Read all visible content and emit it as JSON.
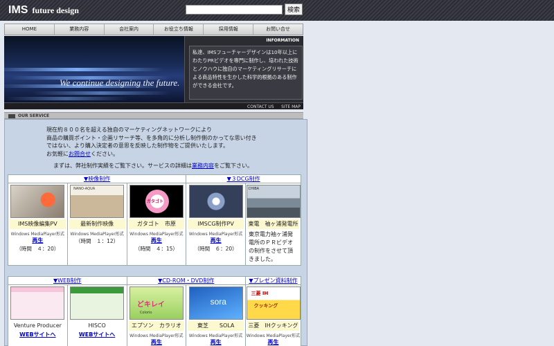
{
  "header": {
    "logo_main": "IMS",
    "logo_sub": "future design",
    "search_placeholder": "",
    "search_button": "検索"
  },
  "nav": [
    "HOME",
    "業務内容",
    "会社案内",
    "お役立ち情報",
    "採用情報",
    "お問い合せ"
  ],
  "hero": {
    "tagline": "We continue designing the future.",
    "info_label": "INFORMATION",
    "info_text": "私達、IMSフューチャーデザインは10年以上にわたりPRビデオを専門に制作し、培われた技術とノウハウに独自のマーケティングリサーチによる商品特性を生かした科学的根拠のある制作ができる会社です。"
  },
  "subnav": [
    "CONTACT US",
    "SITE MAP"
  ],
  "service_header": "OUR SERVICE",
  "intro": {
    "line1": "現在約８００名を超える独自のマーケティングネットワークにより",
    "line2": "商品の購買ポイント・企画リサーチ等、を多角的に分析し制作側のかってな思い付き",
    "line3": "ではない、より購入決定者の意思を反映した制作物をご提供いたします。",
    "line4_pre": "お気軽に",
    "line4_link": "お問合せ",
    "line4_post": "ください。",
    "line5_pre": "まずは、弊社制作実績をご覧下さい。サービスの詳細は",
    "line5_link": "業務内容",
    "line5_post": "をご覧下さい。"
  },
  "sections1": {
    "video": "▼映像制作",
    "cg": "▼３DCG制作"
  },
  "row1": [
    {
      "name": "IMS映像編集PV",
      "format": "Windows MediaPlayer形式",
      "play": "再生",
      "duration": "（時間　４：20）"
    },
    {
      "name": "最新制作映像",
      "format": "Windows MediaPlayer形式",
      "play": "",
      "duration": "（時間　１：12）"
    },
    {
      "name": "ガタゴト　市原",
      "format": "Windows MediaPlayer形式",
      "play": "再生",
      "duration": "（時間　４：15）"
    },
    {
      "name": "IMSCG制作PV",
      "format": "Windows MediaPlayer形式",
      "play": "再生",
      "duration": "（時間　６：20）"
    },
    {
      "name": "東電　袖ヶ浦発電所",
      "desc": "東京電力袖ヶ浦発電所のＰＲビデオの制作をさせて頂きました。"
    }
  ],
  "sections2": {
    "web": "▼WEB制作",
    "cd": "▼CD-ROM・DVD制作",
    "pres": "▼プレゼン資料制作"
  },
  "row2": [
    {
      "name": "Venture Producer",
      "link": "WEBサイトへ"
    },
    {
      "name": "HISCO",
      "link": "WEBサイトへ"
    },
    {
      "name": "エプソン　カラリオ",
      "format": "Windows MediaPlayer形式",
      "play": "再生"
    },
    {
      "name": "東芝　　SOLA",
      "format": "Windows MediaPlayer形式",
      "play": "再生"
    },
    {
      "name": "三菱　IHクッキング",
      "format": "Windows MediaPlayer形式",
      "play": "再生"
    }
  ],
  "thumb_text": {
    "nano": "NANO-AQUA",
    "gatagoto": "ガタゴト",
    "chiba": "CHIBA",
    "sora": "sora",
    "dokirei": "どキレイ",
    "colorio": "Colorio",
    "mitsubishi": "三菱 IH",
    "cooking": "クッキング"
  }
}
